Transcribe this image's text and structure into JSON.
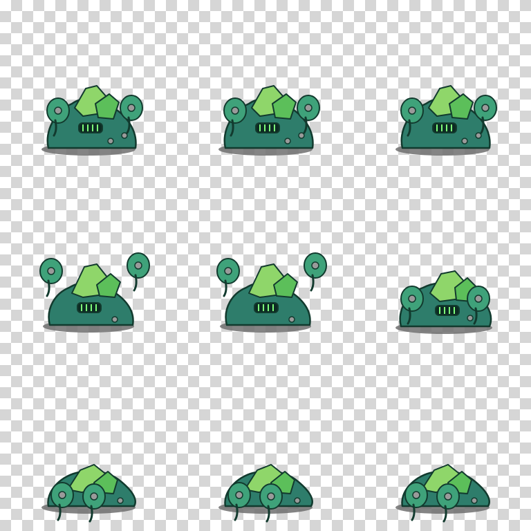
{
  "sprite_sheet": {
    "columns": 3,
    "rows": 3,
    "frames": [
      {
        "row": 1,
        "col": 1,
        "pose": "idle"
      },
      {
        "row": 1,
        "col": 2,
        "pose": "idle"
      },
      {
        "row": 1,
        "col": 3,
        "pose": "idle"
      },
      {
        "row": 2,
        "col": 1,
        "pose": "arms-raised"
      },
      {
        "row": 2,
        "col": 2,
        "pose": "arms-raised"
      },
      {
        "row": 2,
        "col": 3,
        "pose": "hunched"
      },
      {
        "row": 3,
        "col": 1,
        "pose": "collapsed"
      },
      {
        "row": 3,
        "col": 2,
        "pose": "collapsed"
      },
      {
        "row": 3,
        "col": 3,
        "pose": "collapsed"
      }
    ]
  },
  "colors": {
    "checker_light": "#ffffff",
    "checker_dark": "#d6d6d6",
    "body_dark": "#2e7d6b",
    "body_mid": "#3fa27a",
    "crystal_light": "#8fd66a",
    "crystal_mid": "#5cbf5a",
    "outline": "#123a2e",
    "shadow": "#6e6e6e",
    "eye_glow": "#7dff7a",
    "rock": "#9a9a9a"
  }
}
